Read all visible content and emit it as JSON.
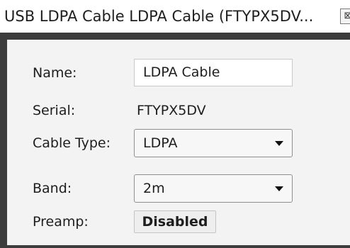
{
  "window": {
    "title": "USB LDPA Cable LDPA Cable (FTYPX5DV...",
    "close_glyph": "⊠"
  },
  "form": {
    "name_label": "Name:",
    "name_value": "LDPA Cable",
    "serial_label": "Serial:",
    "serial_value": "FTYPX5DV",
    "cable_type_label": "Cable Type:",
    "cable_type_value": "LDPA",
    "band_label": "Band:",
    "band_value": "2m",
    "preamp_label": "Preamp:",
    "preamp_value": "Disabled"
  },
  "icons": {
    "close": "close-icon",
    "dropdown": "chevron-down-icon"
  }
}
